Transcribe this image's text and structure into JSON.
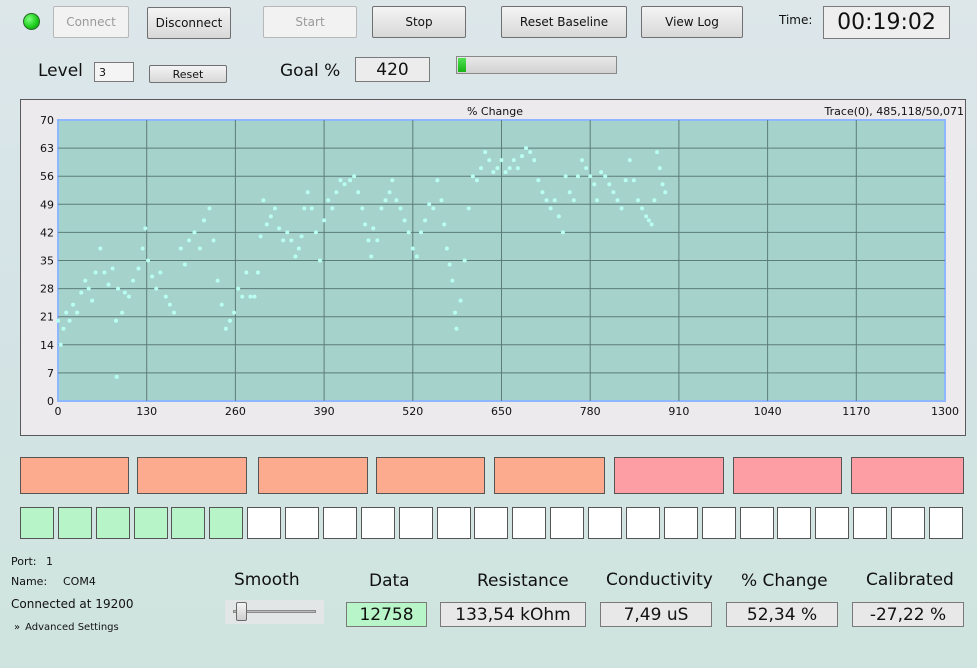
{
  "toolbar": {
    "connect_label": "Connect",
    "disconnect_label": "Disconnect",
    "start_label": "Start",
    "stop_label": "Stop",
    "reset_baseline_label": "Reset Baseline",
    "view_log_label": "View Log",
    "time_label": "Time:",
    "time_value": "00:19:02"
  },
  "level": {
    "label": "Level",
    "value": "3",
    "reset_label": "Reset"
  },
  "goal": {
    "label": "Goal %",
    "value": "420",
    "progress": 0.03
  },
  "chart_data": {
    "type": "scatter",
    "title": "% Change",
    "trace_readout": "Trace(0), 485,118/50,071",
    "xlim": [
      0,
      1300
    ],
    "ylim": [
      0,
      70
    ],
    "xticks": [
      0,
      130,
      260,
      390,
      520,
      650,
      780,
      910,
      1040,
      1170,
      1300
    ],
    "yticks": [
      0,
      7,
      14,
      21,
      28,
      35,
      42,
      49,
      56,
      63,
      70
    ],
    "grid": true,
    "point_color": "#b8fff2",
    "plot_bg": "#a6d2cc",
    "series": [
      {
        "values": [
          [
            0,
            20
          ],
          [
            4,
            14
          ],
          [
            8,
            18
          ],
          [
            12,
            22
          ],
          [
            17,
            20
          ],
          [
            22,
            24
          ],
          [
            28,
            22
          ],
          [
            34,
            27
          ],
          [
            40,
            30
          ],
          [
            45,
            28
          ],
          [
            50,
            25
          ],
          [
            55,
            32
          ],
          [
            62,
            38
          ],
          [
            68,
            32
          ],
          [
            74,
            29
          ],
          [
            80,
            33
          ],
          [
            85,
            20
          ],
          [
            86,
            6
          ],
          [
            88,
            28
          ],
          [
            94,
            22
          ],
          [
            98,
            27
          ],
          [
            104,
            26
          ],
          [
            110,
            30
          ],
          [
            118,
            33
          ],
          [
            124,
            38
          ],
          [
            128,
            43
          ],
          [
            132,
            35
          ],
          [
            138,
            31
          ],
          [
            144,
            28
          ],
          [
            150,
            32
          ],
          [
            158,
            26
          ],
          [
            164,
            24
          ],
          [
            170,
            22
          ],
          [
            180,
            38
          ],
          [
            186,
            34
          ],
          [
            192,
            40
          ],
          [
            200,
            42
          ],
          [
            208,
            38
          ],
          [
            214,
            45
          ],
          [
            222,
            48
          ],
          [
            228,
            40
          ],
          [
            234,
            30
          ],
          [
            240,
            24
          ],
          [
            246,
            18
          ],
          [
            252,
            20
          ],
          [
            258,
            22
          ],
          [
            264,
            28
          ],
          [
            270,
            26
          ],
          [
            276,
            32
          ],
          [
            282,
            26
          ],
          [
            288,
            26
          ],
          [
            293,
            32
          ],
          [
            297,
            41
          ],
          [
            301,
            50
          ],
          [
            306,
            44
          ],
          [
            312,
            46
          ],
          [
            318,
            48
          ],
          [
            324,
            43
          ],
          [
            330,
            40
          ],
          [
            336,
            42
          ],
          [
            342,
            40
          ],
          [
            348,
            36
          ],
          [
            353,
            38
          ],
          [
            357,
            41
          ],
          [
            361,
            48
          ],
          [
            366,
            52
          ],
          [
            372,
            48
          ],
          [
            378,
            42
          ],
          [
            384,
            35
          ],
          [
            390,
            45
          ],
          [
            396,
            50
          ],
          [
            402,
            48
          ],
          [
            408,
            52
          ],
          [
            414,
            55
          ],
          [
            420,
            54
          ],
          [
            428,
            55
          ],
          [
            434,
            56
          ],
          [
            440,
            52
          ],
          [
            446,
            48
          ],
          [
            450,
            44
          ],
          [
            455,
            40
          ],
          [
            459,
            36
          ],
          [
            462,
            43
          ],
          [
            468,
            40
          ],
          [
            474,
            48
          ],
          [
            480,
            50
          ],
          [
            486,
            52
          ],
          [
            490,
            55
          ],
          [
            496,
            50
          ],
          [
            502,
            48
          ],
          [
            508,
            45
          ],
          [
            514,
            42
          ],
          [
            520,
            38
          ],
          [
            526,
            36
          ],
          [
            532,
            42
          ],
          [
            538,
            45
          ],
          [
            544,
            49
          ],
          [
            550,
            48
          ],
          [
            556,
            55
          ],
          [
            562,
            50
          ],
          [
            566,
            44
          ],
          [
            570,
            38
          ],
          [
            574,
            34
          ],
          [
            578,
            30
          ],
          [
            582,
            22
          ],
          [
            584,
            18
          ],
          [
            590,
            25
          ],
          [
            596,
            35
          ],
          [
            602,
            48
          ],
          [
            608,
            56
          ],
          [
            614,
            55
          ],
          [
            620,
            58
          ],
          [
            626,
            62
          ],
          [
            632,
            60
          ],
          [
            638,
            57
          ],
          [
            644,
            58
          ],
          [
            650,
            60
          ],
          [
            656,
            57
          ],
          [
            662,
            58
          ],
          [
            668,
            60
          ],
          [
            674,
            58
          ],
          [
            680,
            61
          ],
          [
            686,
            63
          ],
          [
            692,
            62
          ],
          [
            698,
            60
          ],
          [
            704,
            55
          ],
          [
            710,
            52
          ],
          [
            716,
            50
          ],
          [
            722,
            48
          ],
          [
            728,
            50
          ],
          [
            734,
            46
          ],
          [
            740,
            42
          ],
          [
            744,
            56
          ],
          [
            750,
            52
          ],
          [
            756,
            50
          ],
          [
            762,
            56
          ],
          [
            768,
            60
          ],
          [
            774,
            58
          ],
          [
            780,
            56
          ],
          [
            786,
            54
          ],
          [
            790,
            50
          ],
          [
            796,
            57
          ],
          [
            802,
            56
          ],
          [
            808,
            54
          ],
          [
            814,
            52
          ],
          [
            820,
            50
          ],
          [
            826,
            48
          ],
          [
            832,
            55
          ],
          [
            838,
            60
          ],
          [
            844,
            55
          ],
          [
            850,
            50
          ],
          [
            856,
            48
          ],
          [
            862,
            46
          ],
          [
            866,
            45
          ],
          [
            870,
            44
          ],
          [
            874,
            50
          ],
          [
            878,
            62
          ],
          [
            882,
            58
          ],
          [
            886,
            54
          ],
          [
            890,
            52
          ]
        ]
      }
    ]
  },
  "indicator_blocks": [
    {
      "color": "#fdab8f"
    },
    {
      "color": "#fdab8f"
    },
    {
      "color": "#fdab8f"
    },
    {
      "color": "#fdab8f"
    },
    {
      "color": "#fdab8f"
    },
    {
      "color": "#fd9ea4"
    },
    {
      "color": "#fd9ea4"
    },
    {
      "color": "#fd9ea4"
    }
  ],
  "level_squares": {
    "total": 25,
    "active": 6
  },
  "connection": {
    "port_label": "Port:",
    "port_value": "1",
    "name_label": "Name:",
    "name_value": "COM4",
    "status": "Connected at 19200",
    "advanced_label": "Advanced Settings"
  },
  "smooth": {
    "label": "Smooth",
    "value": 0.05
  },
  "stats": {
    "data_label": "Data",
    "data_value": "12758",
    "resistance_label": "Resistance",
    "resistance_value": "133,54 kOhm",
    "conductivity_label": "Conductivity",
    "conductivity_value": "7,49 uS",
    "change_label": "% Change",
    "change_value": "52,34 %",
    "calibrated_label": "Calibrated",
    "calibrated_value": "-27,22 %"
  }
}
